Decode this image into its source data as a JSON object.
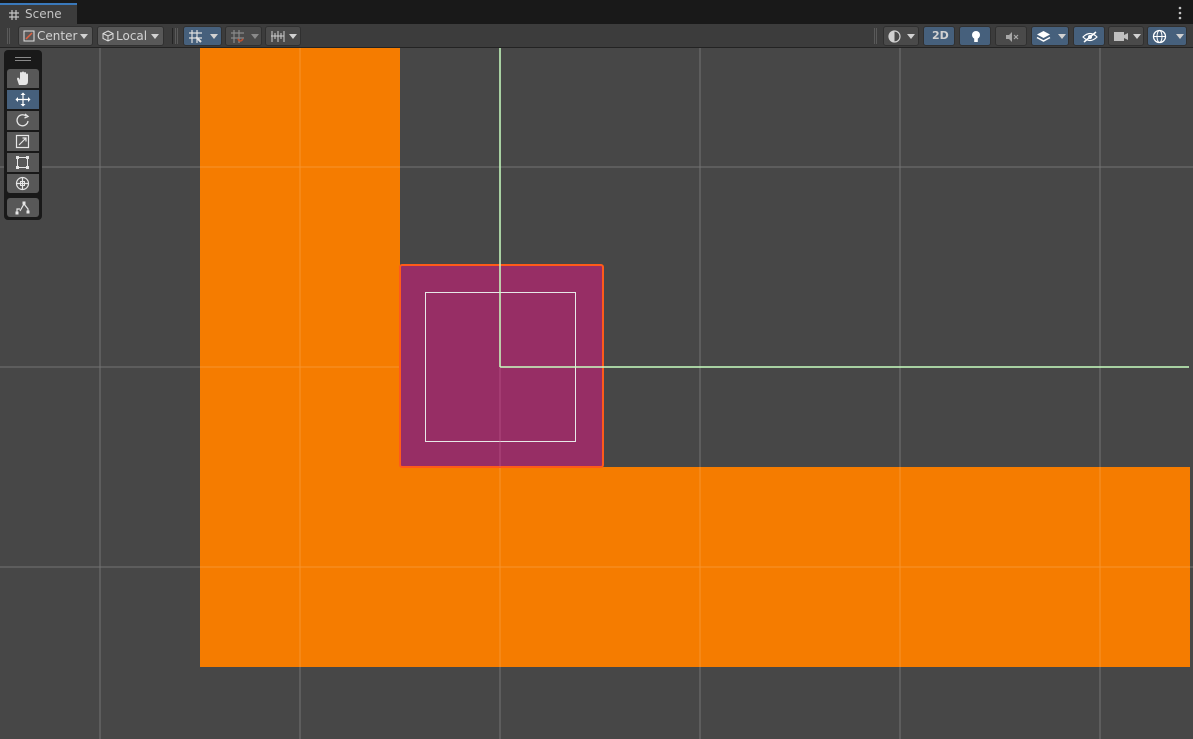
{
  "window": {
    "tab_label": "Scene",
    "tab_icon": "grid-hash-icon",
    "menu_icon": "kebab-menu-icon"
  },
  "toolbar": {
    "pivot_mode": "Center",
    "pivot_rotation": "Local",
    "mode_2d_label": "2D",
    "left_tools": [
      {
        "name": "grid-snapping",
        "icon": "grid-snap-icon",
        "active": true
      },
      {
        "name": "incremental-snap",
        "icon": "snap-increment-icon",
        "active": false
      },
      {
        "name": "snap-settings",
        "icon": "ruler-snap-icon",
        "active": false
      }
    ],
    "right_tools": [
      {
        "name": "draw-mode",
        "icon": "shading-sphere-icon",
        "active": false
      },
      {
        "name": "2d-toggle",
        "icon": "2d-text",
        "active": true
      },
      {
        "name": "lighting-toggle",
        "icon": "lightbulb-icon",
        "active": true
      },
      {
        "name": "audio-toggle",
        "icon": "audio-mute-icon",
        "active": false
      },
      {
        "name": "effects-toggle",
        "icon": "layers-effects-icon",
        "active": true
      },
      {
        "name": "scene-visibility",
        "icon": "eye-hidden-icon",
        "active": true
      },
      {
        "name": "camera-settings",
        "icon": "camera-icon",
        "active": false
      },
      {
        "name": "gizmos",
        "icon": "gizmo-globe-icon",
        "active": true
      }
    ]
  },
  "tools_panel": [
    {
      "name": "view-tool",
      "icon": "hand-icon",
      "active": false
    },
    {
      "name": "move-tool",
      "icon": "move-arrows-icon",
      "active": true
    },
    {
      "name": "rotate-tool",
      "icon": "rotate-icon",
      "active": false
    },
    {
      "name": "scale-tool",
      "icon": "scale-icon",
      "active": false
    },
    {
      "name": "rect-tool",
      "icon": "rect-transform-icon",
      "active": false
    },
    {
      "name": "transform-tool",
      "icon": "transform-icon",
      "active": false
    },
    {
      "name": "custom-tool",
      "icon": "custom-editor-tool-icon",
      "active": false
    }
  ],
  "colors": {
    "viewport_bg": "#474747",
    "grid_line": "#737373",
    "orange_sprite": "#f57c00",
    "selected_sprite": "#972e65",
    "selection_outline": "#ff5a1a",
    "axis_line": "#c8ffc0",
    "active_button": "#46607c"
  }
}
